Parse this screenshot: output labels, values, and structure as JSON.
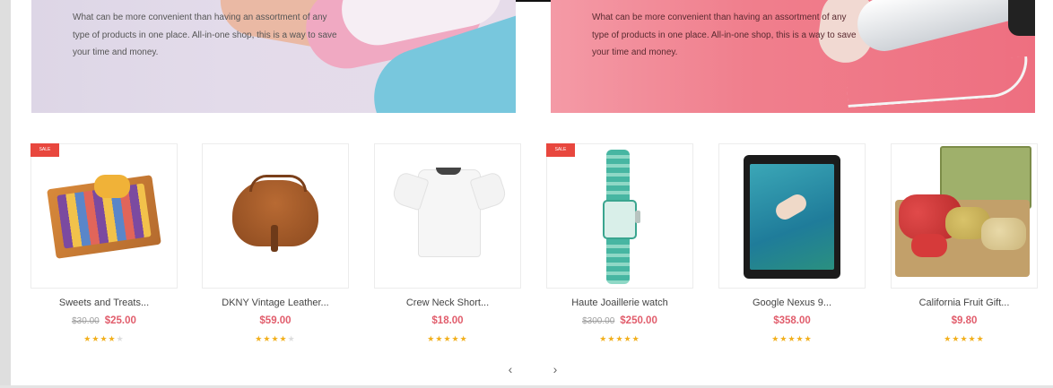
{
  "banners": [
    {
      "text": "What can be more convenient than having an assortment of any type of products in one place. All-in-one shop, this is a way to save your time and money."
    },
    {
      "text": "What can be more convenient than having an assortment of any type of products in one place. All-in-one shop, this is a way to save your time and money."
    }
  ],
  "products": [
    {
      "name": "Sweets and Treats...",
      "old_price": "$30.00",
      "price": "$25.00",
      "rating": 4,
      "badge": "SALE"
    },
    {
      "name": "DKNY Vintage Leather...",
      "old_price": "",
      "price": "$59.00",
      "rating": 4,
      "badge": ""
    },
    {
      "name": "Crew Neck Short...",
      "old_price": "",
      "price": "$18.00",
      "rating": 5,
      "badge": ""
    },
    {
      "name": "Haute Joaillerie watch",
      "old_price": "$300.00",
      "price": "$250.00",
      "rating": 5,
      "badge": "SALE"
    },
    {
      "name": "Google Nexus 9...",
      "old_price": "",
      "price": "$358.00",
      "rating": 5,
      "badge": ""
    },
    {
      "name": "California Fruit Gift...",
      "old_price": "",
      "price": "$9.80",
      "rating": 5,
      "badge": ""
    }
  ],
  "carousel": {
    "prev_icon": "chevron-left-icon",
    "next_icon": "chevron-right-icon",
    "prev_glyph": "‹",
    "next_glyph": "›"
  },
  "colors": {
    "price": "#e15d6c",
    "star": "#f2b01e",
    "badge": "#e8473e"
  }
}
